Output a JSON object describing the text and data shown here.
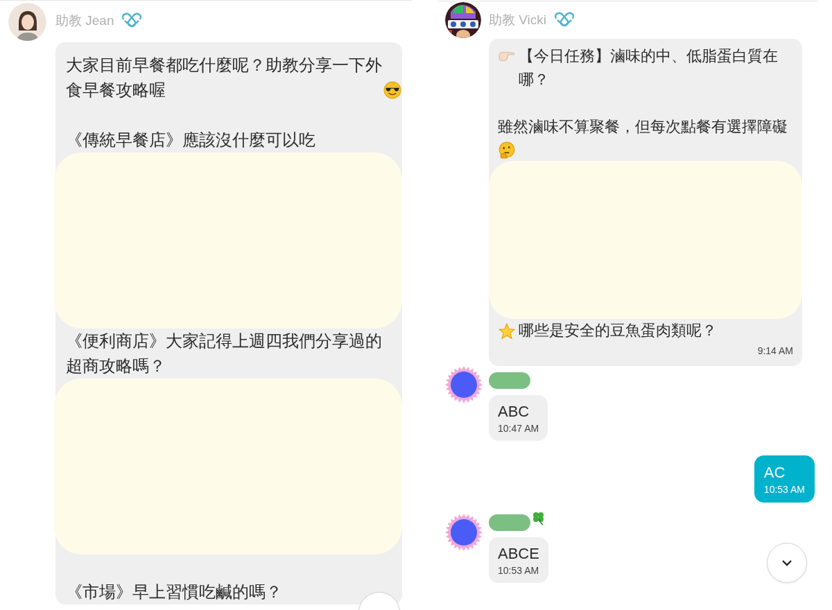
{
  "panels": [
    {
      "scroll_button": true,
      "messages": [
        {
          "kind": "incoming",
          "sender": {
            "kind": "named",
            "name": "助教 Jean",
            "verified": true,
            "avatar": {
              "kind": "cartoon"
            }
          },
          "parts": [
            {
              "kind": "text",
              "text": "大家目前早餐都吃什麼呢？助教分享一下外食早餐攻略喔"
            },
            {
              "kind": "text",
              "text": "《傳統早餐店》應該沒什麼可以吃",
              "gap_before": true
            },
            {
              "kind": "redaction"
            },
            {
              "kind": "text",
              "text": "《便利商店》大家記得上週四我們分享過的超商攻略嗎？"
            },
            {
              "kind": "redaction"
            },
            {
              "kind": "text",
              "text": "《市場》早上習慣吃鹹的嗎？",
              "gap_before": true
            }
          ]
        }
      ]
    },
    {
      "scroll_button": true,
      "messages": [
        {
          "kind": "incoming",
          "sender": {
            "kind": "named",
            "name": "助教 Vicki",
            "verified": true
          },
          "parts": [
            {
              "kind": "text",
              "text": "【今日任務】滷味的中、低脂蛋白質在哪？"
            },
            {
              "kind": "text",
              "text": "雖然滷味不算聚餐，但每次點餐有選擇障礙",
              "gap_before": true
            },
            {
              "kind": "redaction"
            },
            {
              "kind": "text",
              "text": "哪些是安全的豆魚蛋肉類呢？"
            }
          ],
          "time": "9:14 AM"
        },
        {
          "kind": "incoming",
          "sender": {
            "kind": "hidden",
            "avatar": {
              "kind": "flower"
            }
          },
          "parts": [
            {
              "kind": "text",
              "text": "ABC"
            }
          ],
          "time": "10:47 AM"
        },
        {
          "kind": "outgoing",
          "parts": [
            {
              "kind": "text",
              "text": "AC"
            }
          ],
          "time": "10:53 AM"
        },
        {
          "kind": "incoming",
          "sender": {
            "kind": "hidden",
            "avatar": {
              "kind": "flower"
            }
          },
          "parts": [
            {
              "kind": "text",
              "text": "ABCE"
            }
          ],
          "time": "10:53 AM"
        }
      ]
    }
  ]
}
